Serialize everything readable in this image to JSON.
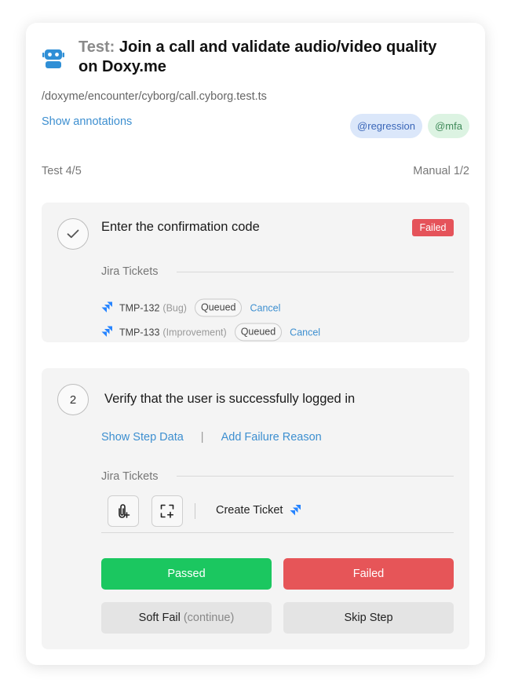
{
  "header": {
    "title_prefix": "Test:",
    "title": "Join a call and validate audio/video quality on Doxy.me",
    "path": "/doxyme/encounter/cyborg/call.cyborg.test.ts",
    "annotations_link": "Show annotations"
  },
  "tags": [
    "@regression",
    "@mfa"
  ],
  "counters": {
    "test": "Test 4/5",
    "manual": "Manual 1/2"
  },
  "step1": {
    "text": "Enter the confirmation code",
    "status": "Failed",
    "jira_label": "Jira Tickets",
    "tickets": [
      {
        "id": "TMP-132",
        "type": "(Bug)",
        "state": "Queued",
        "action": "Cancel"
      },
      {
        "id": "TMP-133",
        "type": "(Improvement)",
        "state": "Queued",
        "action": "Cancel"
      }
    ]
  },
  "step2": {
    "number": "2",
    "text": "Verify that the user is successfully logged in",
    "show_data": "Show Step Data",
    "separator": "|",
    "add_reason": "Add Failure Reason",
    "jira_label": "Jira Tickets",
    "create_ticket": "Create Ticket",
    "buttons": {
      "passed": "Passed",
      "failed": "Failed",
      "soft_fail": "Soft Fail",
      "soft_fail_note": "(continue)",
      "skip": "Skip Step"
    }
  },
  "colors": {
    "link": "#3d8fd0",
    "passed": "#1bc760",
    "failed": "#e65558",
    "badge_failed": "#e5535a",
    "robot": "#2f8fd6",
    "jira": "#2684ff"
  }
}
